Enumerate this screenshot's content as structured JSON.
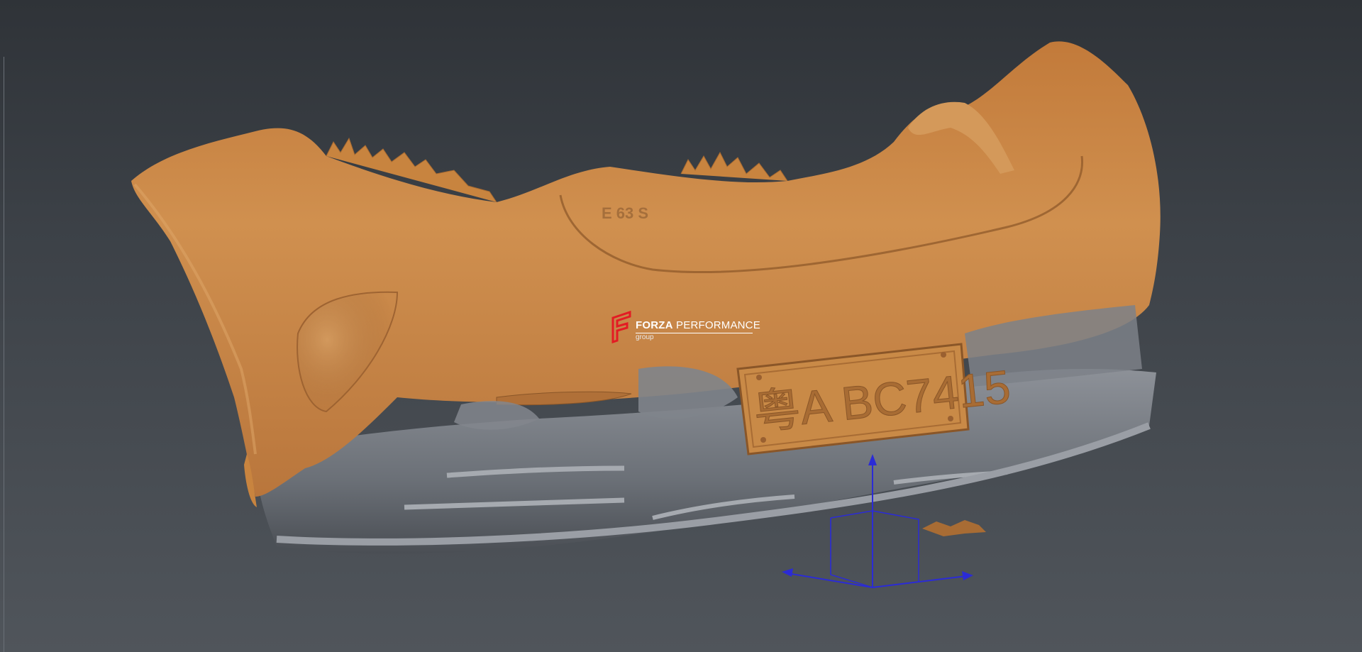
{
  "viewport": {
    "background_top": "#2f3338",
    "background_bottom": "#50555b"
  },
  "model": {
    "name": "rear-bumper-3d-scan",
    "scan_color": "#c8884a",
    "base_color": "#7c8087",
    "plate_text": "粤A BC7415",
    "badge_text": "E 63 S"
  },
  "watermark": {
    "brand_bold": "FORZA",
    "brand_rest": " PERFORMANCE",
    "subtitle": "group",
    "logo_color": "#e31b23"
  },
  "gizmo": {
    "color": "#2b2bd6",
    "icon": "move-gizmo-icon"
  }
}
